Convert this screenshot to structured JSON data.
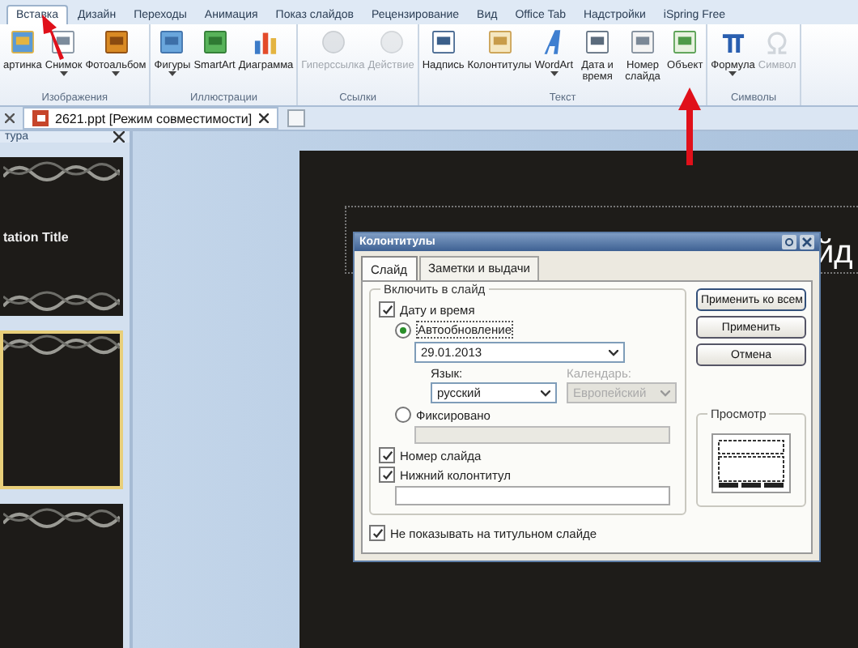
{
  "ribbon_tabs": [
    {
      "label": "Вставка",
      "selected": true
    },
    {
      "label": "Дизайн",
      "selected": false
    },
    {
      "label": "Переходы",
      "selected": false
    },
    {
      "label": "Анимация",
      "selected": false
    },
    {
      "label": "Показ слайдов",
      "selected": false
    },
    {
      "label": "Рецензирование",
      "selected": false
    },
    {
      "label": "Вид",
      "selected": false
    },
    {
      "label": "Office Tab",
      "selected": false
    },
    {
      "label": "Надстройки",
      "selected": false
    },
    {
      "label": "iSpring Free",
      "selected": false
    }
  ],
  "ribbon_groups": [
    {
      "label": "Изображения",
      "commands": [
        {
          "label": "артинка",
          "kind": "clipart",
          "disabled": false,
          "dropdown": false,
          "two_line": false
        },
        {
          "label": "Снимок",
          "kind": "screenshot",
          "disabled": false,
          "dropdown": true,
          "two_line": false
        },
        {
          "label": "Фотоальбом",
          "kind": "album",
          "disabled": false,
          "dropdown": true,
          "two_line": false
        }
      ]
    },
    {
      "label": "Иллюстрации",
      "commands": [
        {
          "label": "Фигуры",
          "kind": "shapes",
          "disabled": false,
          "dropdown": true,
          "two_line": false
        },
        {
          "label": "SmartArt",
          "kind": "smartart",
          "disabled": false,
          "dropdown": false,
          "two_line": false
        },
        {
          "label": "Диаграмма",
          "kind": "chart",
          "disabled": false,
          "dropdown": false,
          "two_line": false
        }
      ]
    },
    {
      "label": "Ссылки",
      "commands": [
        {
          "label": "Гиперссылка",
          "kind": "link",
          "disabled": true,
          "dropdown": false,
          "two_line": false
        },
        {
          "label": "Действие",
          "kind": "action",
          "disabled": true,
          "dropdown": false,
          "two_line": false
        }
      ]
    },
    {
      "label": "Текст",
      "commands": [
        {
          "label": "Надпись",
          "kind": "textbox",
          "disabled": false,
          "dropdown": false,
          "two_line": false
        },
        {
          "label": "Колонтитулы",
          "kind": "header",
          "disabled": false,
          "dropdown": false,
          "two_line": false
        },
        {
          "label": "WordArt",
          "kind": "wordart",
          "disabled": false,
          "dropdown": true,
          "two_line": false
        },
        {
          "label": "Дата и время",
          "kind": "datetime",
          "disabled": false,
          "dropdown": false,
          "two_line": true
        },
        {
          "label": "Номер слайда",
          "kind": "slidenum",
          "disabled": false,
          "dropdown": false,
          "two_line": true
        },
        {
          "label": "Объект",
          "kind": "object",
          "disabled": false,
          "dropdown": false,
          "two_line": false
        }
      ]
    },
    {
      "label": "Символы",
      "commands": [
        {
          "label": "Формула",
          "kind": "equation",
          "disabled": false,
          "dropdown": true,
          "two_line": false
        },
        {
          "label": "Символ",
          "kind": "symbol",
          "disabled": true,
          "dropdown": false,
          "two_line": false
        }
      ]
    }
  ],
  "document_tab": {
    "title": "2621.ppt [Режим совместимости]"
  },
  "outline_panel": {
    "title": "тура",
    "slides": [
      {
        "title": "tation Title",
        "selected": false
      },
      {
        "selected": true
      },
      {
        "selected": false
      }
    ]
  },
  "slide": {
    "title": "йд"
  },
  "dialog": {
    "title": "Колонтитулы",
    "tabs": [
      {
        "label": "Слайд",
        "selected": true
      },
      {
        "label": "Заметки и выдачи",
        "selected": false
      }
    ],
    "group_title": "Включить в слайд",
    "date_time": {
      "label": "Дату и время",
      "checked": true
    },
    "auto_update": {
      "label": "Автообновление",
      "selected": true
    },
    "date_value": "29.01.2013",
    "language": {
      "label": "Язык:",
      "value": "русский"
    },
    "calendar": {
      "label": "Календарь:",
      "value": "Европейский",
      "disabled": true
    },
    "fixed": {
      "label": "Фиксировано",
      "selected": false
    },
    "slide_number": {
      "label": "Номер слайда",
      "checked": true
    },
    "footer": {
      "label": "Нижний колонтитул",
      "checked": true
    },
    "hide_on_title": {
      "label": "Не показывать на титульном слайде",
      "checked": true
    },
    "buttons": [
      "Применить ко всем",
      "Применить",
      "Отмена"
    ],
    "preview_title": "Просмотр"
  }
}
